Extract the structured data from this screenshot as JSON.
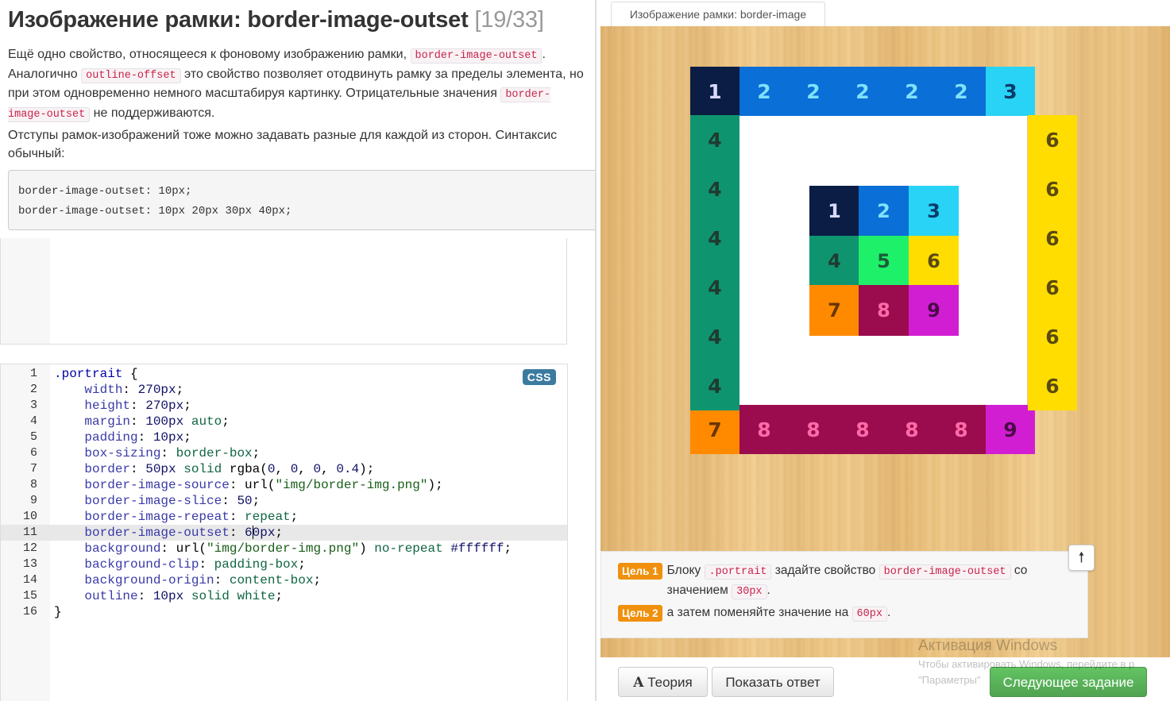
{
  "lesson": {
    "title": "Изображение рамки: border-image-outset",
    "counter": "[19/33]",
    "p1_a": "Ещё одно свойство, относящееся к фоновому изображению рамки,",
    "p1_code1": "border-image-outset",
    "p1_b": ". Аналогично",
    "p1_code2": "outline-offset",
    "p1_c": "это свойство позволяет отодвинуть рамку за пределы элемента, но при этом одновременно немного масштабируя картинку. Отрицательные значения",
    "p1_code3": "border-image-outset",
    "p1_d": "не поддерживаются.",
    "p2": "Отступы рамок-изображений тоже можно задавать разные для каждой из сторон. Синтаксис обычный:",
    "example_line1": "border-image-outset: 10px;",
    "example_line2": "border-image-outset: 10px 20px 30px 40px;"
  },
  "editor": {
    "badge": "CSS",
    "active_line": 11,
    "lines": [
      {
        "n": "1"
      },
      {
        "n": "2"
      },
      {
        "n": "3"
      },
      {
        "n": "4"
      },
      {
        "n": "5"
      },
      {
        "n": "6"
      },
      {
        "n": "7"
      },
      {
        "n": "8"
      },
      {
        "n": "9"
      },
      {
        "n": "10"
      },
      {
        "n": "11"
      },
      {
        "n": "12"
      },
      {
        "n": "13"
      },
      {
        "n": "14"
      },
      {
        "n": "15"
      },
      {
        "n": "16"
      }
    ],
    "code": {
      "l1_sel": ".portrait",
      "l1_brace": " {",
      "l2_p": "width",
      "l2_v": "270px",
      "l3_p": "height",
      "l3_v": "270px",
      "l4_p": "margin",
      "l4_v1": "100px",
      "l4_v2": "auto",
      "l5_p": "padding",
      "l5_v": "10px",
      "l6_p": "box-sizing",
      "l6_v": "border-box",
      "l7_p": "border",
      "l7_v1": "50px",
      "l7_v2": "solid",
      "l7_v3": "rgba(",
      "l7_n1": "0",
      "l7_n2": "0",
      "l7_n3": "0",
      "l7_n4": "0.4",
      "l7_v4": ")",
      "l8_p": "border-image-source",
      "l8_f": "url(",
      "l8_s": "\"img/border-img.png\"",
      "l8_e": ")",
      "l9_p": "border-image-slice",
      "l9_v": "50",
      "l10_p": "border-image-repeat",
      "l10_v": "repeat",
      "l11_p": "border-image-outset",
      "l11_v_a": "6",
      "l11_v_b": "0px",
      "l12_p": "background",
      "l12_f": "url(",
      "l12_s": "\"img/border-img.png\"",
      "l12_e": ")",
      "l12_v1": "no-repeat",
      "l12_v2": "#ffffff",
      "l13_p": "background-clip",
      "l13_v": "padding-box",
      "l14_p": "background-origin",
      "l14_v": "content-box",
      "l15_p": "outline",
      "l15_v1": "10px",
      "l15_v2": "solid",
      "l15_v3": "white",
      "l16": "}"
    }
  },
  "preview": {
    "tab_label": "Изображение рамки: border-image",
    "top_numbers": [
      "1",
      "2",
      "2",
      "2",
      "2",
      "2",
      "3"
    ],
    "left_numbers": [
      "4",
      "4",
      "4",
      "4",
      "4",
      "4"
    ],
    "right_numbers": [
      "6",
      "6",
      "6",
      "6",
      "6",
      "6"
    ],
    "bottom_numbers": [
      "7",
      "8",
      "8",
      "8",
      "8",
      "8",
      "9"
    ],
    "grid_numbers": [
      "1",
      "2",
      "3",
      "4",
      "5",
      "6",
      "7",
      "8",
      "9"
    ],
    "colors": {
      "c1": "#0b1d45",
      "c2": "#0a6fd6",
      "c3": "#28d3f5",
      "c4": "#0f9470",
      "c5": "#1ff06a",
      "c6": "#ffdd00",
      "c7": "#ff8a00",
      "c8": "#9a0c4e",
      "c9": "#d21ed2"
    }
  },
  "goals": {
    "g1_tag": "Цель 1",
    "g1_a": "Блоку",
    "g1_code1": ".portrait",
    "g1_b": "задайте свойство",
    "g1_code2": "border-image-outset",
    "g1_c": "со значением",
    "g1_code3": "30px",
    "g1_d": ".",
    "g2_tag": "Цель 2",
    "g2_a": "а затем поменяйте значение на",
    "g2_code": "60px",
    "g2_b": "."
  },
  "buttons": {
    "theory": "Теория",
    "show_answer": "Показать ответ",
    "next": "Следующее задание",
    "up_arrow": "🠕"
  },
  "watermark": {
    "line1": "Активация Windows",
    "line2": "Чтобы активировать Windows, перейдите в р",
    "line3": "\"Параметры\""
  }
}
